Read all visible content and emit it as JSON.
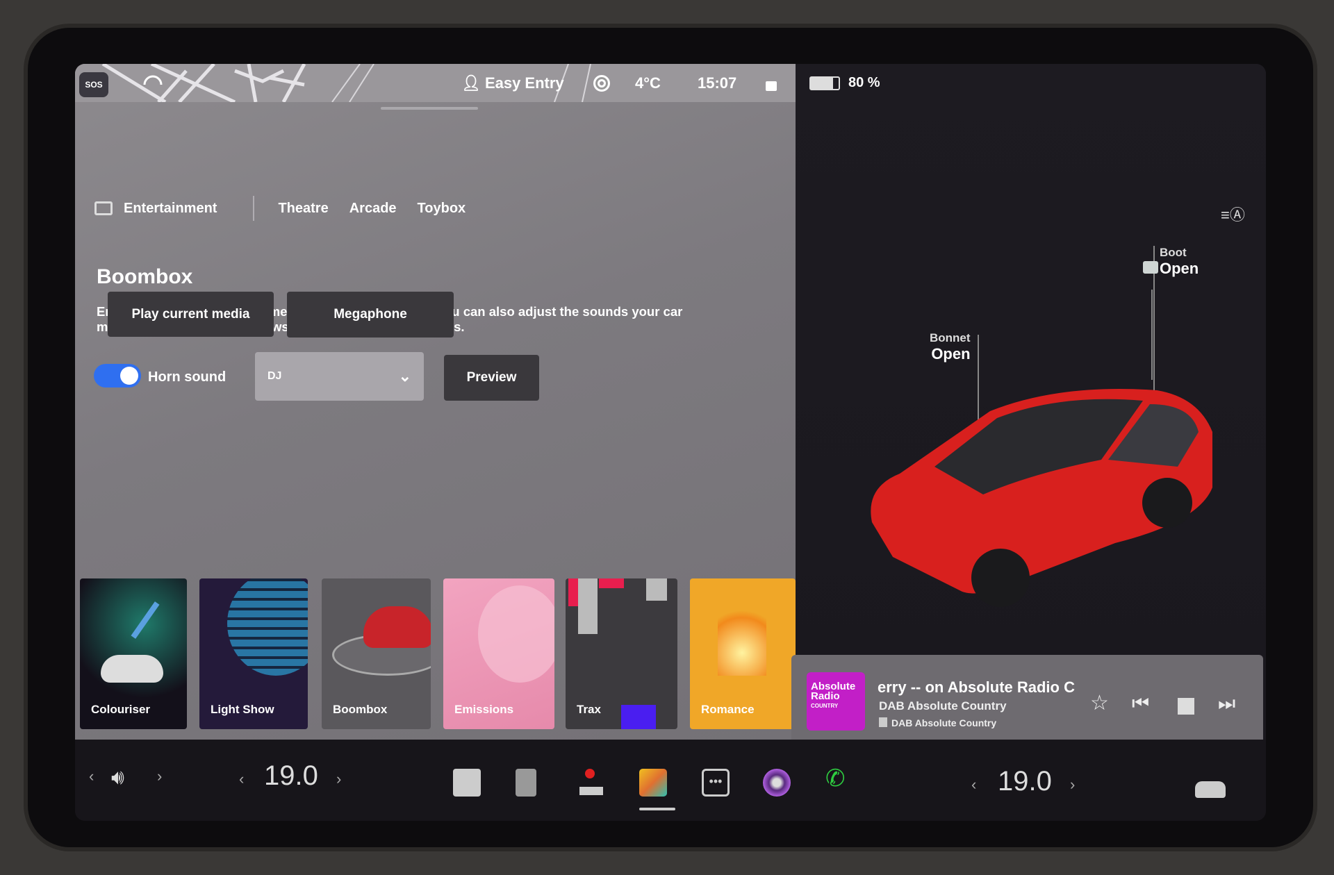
{
  "status_bar": {
    "sos": "SOS",
    "profile": "Easy Entry",
    "temperature": "4°C",
    "time": "15:07",
    "battery": "80 %",
    "battery_level": 80
  },
  "nav": {
    "section": "Entertainment",
    "tabs": [
      "Theatre",
      "Arcade",
      "Toybox"
    ]
  },
  "boombox": {
    "title": "Boombox",
    "description": "Entertain a crowd with your media player when parked. You can also adjust the sounds your car makes. Please check local laws before use in public spaces.",
    "play_button": "Play current media",
    "megaphone_button": "Megaphone",
    "horn_label": "Horn sound",
    "horn_enabled": true,
    "horn_selected": "DJ",
    "preview_button": "Preview"
  },
  "tiles": [
    {
      "label": "Colouriser"
    },
    {
      "label": "Light Show"
    },
    {
      "label": "Boombox"
    },
    {
      "label": "Emissions"
    },
    {
      "label": "Trax"
    },
    {
      "label": "Romance"
    }
  ],
  "car": {
    "bonnet_label": "Bonnet",
    "bonnet_state": "Open",
    "boot_label": "Boot",
    "boot_state": "Open",
    "color": "#d8201e"
  },
  "media": {
    "logo_line1": "Absolute",
    "logo_line2": "Radio",
    "logo_line3": "COUNTRY",
    "title": "erry -- on Absolute Radio C",
    "station": "DAB Absolute Country",
    "source": "DAB Absolute Country",
    "accent": "#c21fc7"
  },
  "bottom_bar": {
    "driver_temp": "19.0",
    "passenger_temp": "19.0"
  }
}
